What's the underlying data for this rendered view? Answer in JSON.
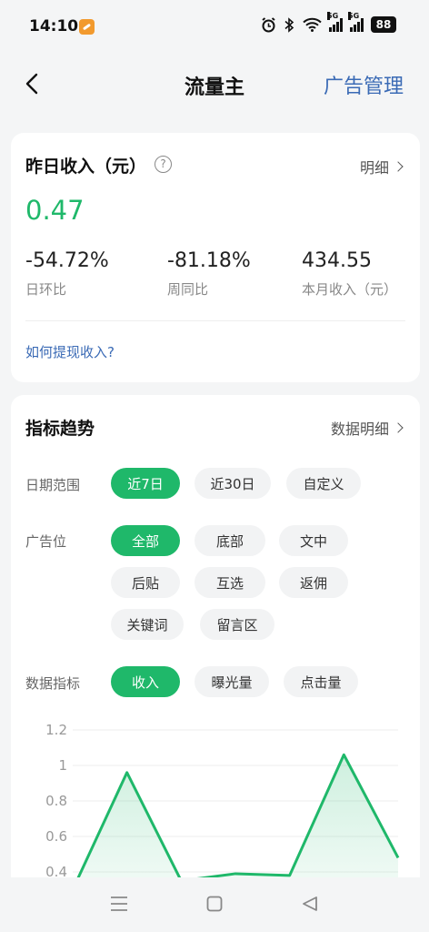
{
  "status_bar": {
    "time": "14:10",
    "network": "5G",
    "battery": "88"
  },
  "nav": {
    "title": "流量主",
    "action": "广告管理"
  },
  "summary": {
    "title": "昨日收入（元）",
    "help": "?",
    "detail_link": "明细",
    "yesterday_income": "0.47",
    "stats": [
      {
        "value": "-54.72%",
        "label": "日环比"
      },
      {
        "value": "-81.18%",
        "label": "周同比"
      },
      {
        "value": "434.55",
        "label": "本月收入（元）"
      }
    ],
    "howto_link": "如何提现收入?"
  },
  "trend": {
    "title": "指标趋势",
    "detail_link": "数据明细",
    "date_range": {
      "label": "日期范围",
      "options": [
        "近7日",
        "近30日",
        "自定义"
      ],
      "selected": "近7日"
    },
    "ad_slot": {
      "label": "广告位",
      "options": [
        "全部",
        "底部",
        "文中",
        "后贴",
        "互选",
        "返佣",
        "关键词",
        "留言区"
      ],
      "selected": "全部"
    },
    "metric": {
      "label": "数据指标",
      "options": [
        "收入",
        "曝光量",
        "点击量"
      ],
      "selected": "收入"
    }
  },
  "chart_data": {
    "type": "area",
    "series": [
      {
        "values": [
          0.3,
          0.96,
          0.35,
          0.39,
          0.38,
          1.06,
          0.48
        ]
      }
    ],
    "y_ticks": [
      "1.2",
      "1",
      "0.8",
      "0.6",
      "0.4"
    ],
    "ylim": [
      0,
      1.2
    ],
    "grid": true,
    "line_color": "#1fb86a"
  },
  "colors": {
    "accent": "#1fb86a",
    "link": "#3a6ab5"
  }
}
